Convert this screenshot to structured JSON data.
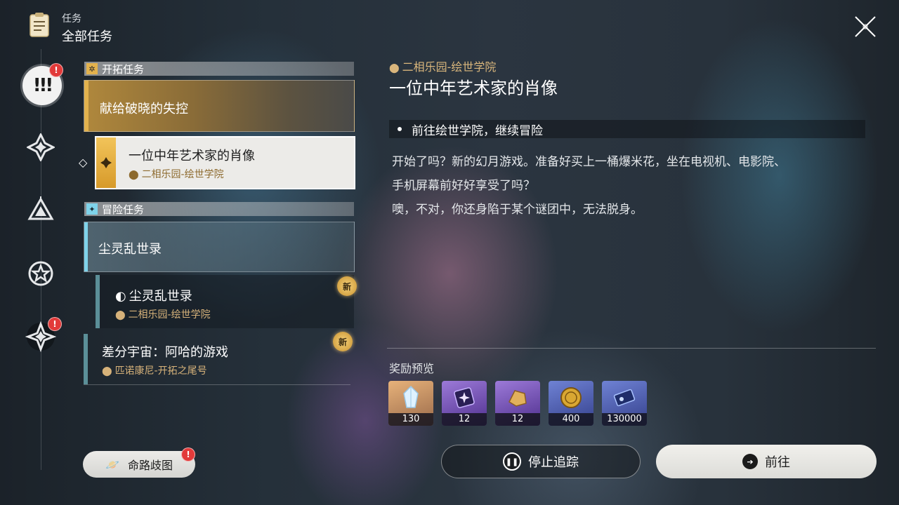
{
  "header": {
    "category": "任务",
    "title": "全部任务"
  },
  "colors": {
    "gold": "#e3b24d",
    "blue_accent": "#7fd3ea",
    "alert": "#e23a3a",
    "location_text": "#d9b67c"
  },
  "rail": {
    "items": [
      {
        "icon": "exclamation-icon",
        "glyph": "!!!",
        "active": true,
        "alert": "!"
      },
      {
        "icon": "trailblaze-star-icon",
        "active": false
      },
      {
        "icon": "triangle-emblem-icon",
        "active": false
      },
      {
        "icon": "star-badge-icon",
        "active": false
      },
      {
        "icon": "compass-star-icon",
        "active": false,
        "alert": "!"
      }
    ]
  },
  "sections": {
    "trailblaze": {
      "label": "开拓任务",
      "missions": [
        {
          "title": "献给破晓的失控"
        },
        {
          "title": "一位中年艺术家的肖像",
          "location": "二相乐园-绘世学院",
          "selected": true
        }
      ]
    },
    "adventure": {
      "label": "冒险任务",
      "missions": [
        {
          "title": "尘灵乱世录"
        },
        {
          "title": "尘灵乱世录",
          "location": "二相乐园-绘世学院",
          "new_badge": "新"
        },
        {
          "title": "差分宇宙：阿哈的游戏",
          "location": "匹诺康尼-开拓之尾号",
          "new_badge": "新"
        }
      ]
    }
  },
  "detail": {
    "location": "二相乐园-绘世学院",
    "title": "一位中年艺术家的肖像",
    "objective": "前往绘世学院，继续冒险",
    "description": [
      "开始了吗？新的幻月游戏。准备好买上一桶爆米花，坐在电视机、电影院、",
      "手机屏幕前好好享受了吗？",
      "噢，不对，你还身陷于某个谜团中，无法脱身。"
    ],
    "reward_label": "奖励预览",
    "rewards": [
      {
        "icon": "crystal-icon",
        "count": "130",
        "rarity_color": "#c7875a"
      },
      {
        "icon": "purple-ticket-icon",
        "count": "12",
        "rarity_color": "#6f4ab3"
      },
      {
        "icon": "gold-ore-icon",
        "count": "12",
        "rarity_color": "#6f4ab3"
      },
      {
        "icon": "credit-coin-icon",
        "count": "400",
        "rarity_color": "#4a5aa8"
      },
      {
        "icon": "blue-ticket-icon",
        "count": "130000",
        "rarity_color": "#4a5aa8"
      }
    ]
  },
  "buttons": {
    "route": "命路歧图",
    "route_alert": "!",
    "stop": "停止追踪",
    "go": "前往"
  }
}
